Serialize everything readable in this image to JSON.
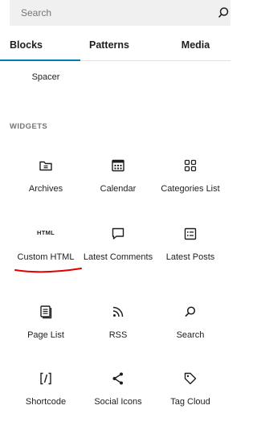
{
  "search": {
    "placeholder": "Search",
    "value": ""
  },
  "tabs": [
    {
      "label": "Blocks",
      "active": true
    },
    {
      "label": "Patterns",
      "active": false
    },
    {
      "label": "Media",
      "active": false
    }
  ],
  "spacer": {
    "label": "Spacer"
  },
  "widgets": {
    "title": "WIDGETS",
    "items": [
      {
        "label": "Archives",
        "icon": "archives-icon"
      },
      {
        "label": "Calendar",
        "icon": "calendar-icon"
      },
      {
        "label": "Categories List",
        "icon": "categories-icon"
      },
      {
        "label": "Custom HTML",
        "icon": "html-icon",
        "icon_text": "HTML"
      },
      {
        "label": "Latest Comments",
        "icon": "comment-icon"
      },
      {
        "label": "Latest Posts",
        "icon": "latest-posts-icon"
      },
      {
        "label": "Page List",
        "icon": "page-list-icon"
      },
      {
        "label": "RSS",
        "icon": "rss-icon"
      },
      {
        "label": "Search",
        "icon": "search-icon"
      },
      {
        "label": "Shortcode",
        "icon": "shortcode-icon",
        "icon_text": "[/]"
      },
      {
        "label": "Social Icons",
        "icon": "share-icon"
      },
      {
        "label": "Tag Cloud",
        "icon": "tag-icon"
      }
    ]
  },
  "colors": {
    "accent": "#007cba",
    "annotation": "#e00000",
    "muted": "#757575",
    "search_bg": "#f0f0f0"
  }
}
